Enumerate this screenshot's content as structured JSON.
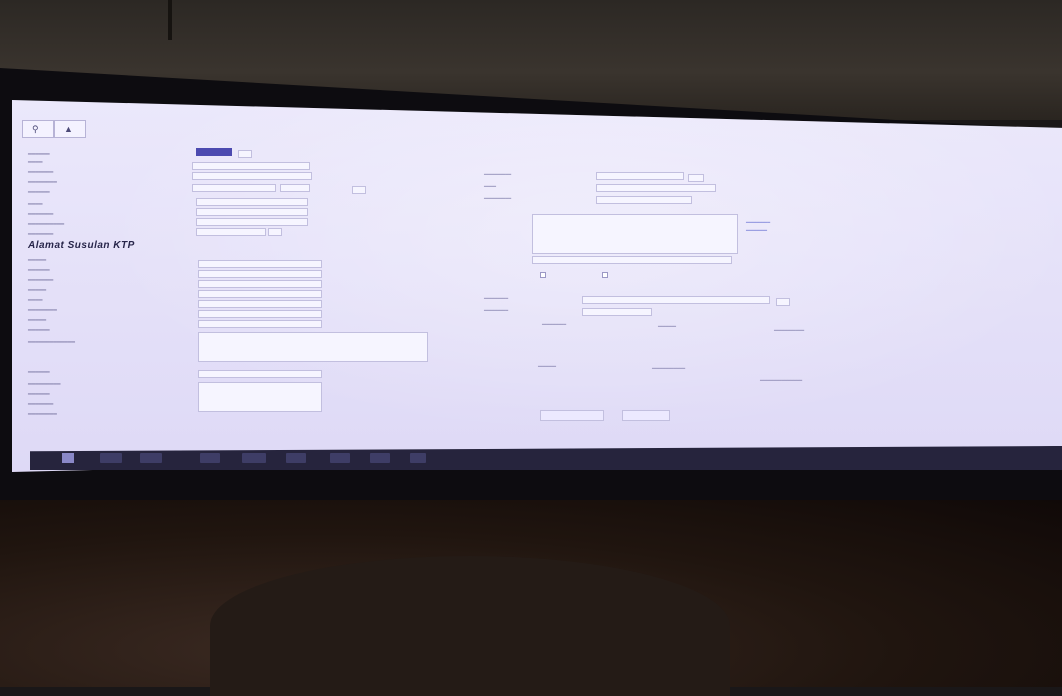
{
  "environment": {
    "wall_color": "#2c2824",
    "bezel_color": "#0d0c10",
    "screen_color": "#e6e3fa",
    "desk_color": "#2a1c15",
    "taskbar_color": "#26243d"
  },
  "window": {
    "title": "",
    "tab_icons": [
      "search-icon",
      "mountain-icon"
    ]
  },
  "form": {
    "section_label": "",
    "highlighted_label": "Alamat Susulan KTP",
    "selected_field_color": "#4c4ab0"
  },
  "buttons": {
    "primary_label": "",
    "secondary_label": ""
  },
  "taskbar": {
    "item_count": 8
  }
}
